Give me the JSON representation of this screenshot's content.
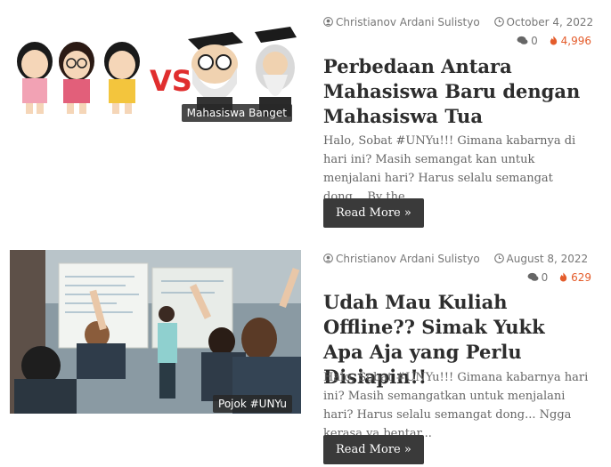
{
  "posts": [
    {
      "author": "Christianov Ardani Sulistyo",
      "date": "October 4, 2022",
      "comments": "0",
      "views": "4,996",
      "category": "Mahasiswa Banget",
      "title": "Perbedaan Antara Mahasiswa Baru dengan Mahasiswa Tua",
      "excerpt": "Halo, Sobat #UNYu!!! Gimana kabarnya di hari ini? Masih semangat kan untuk menjalani hari? Harus selalu semangat dong... By the...",
      "read_more": "Read More »",
      "image_text": "VS"
    },
    {
      "author": "Christianov Ardani Sulistyo",
      "date": "August 8, 2022",
      "comments": "0",
      "views": "629",
      "category": "Pojok #UNYu",
      "title": "Udah Mau Kuliah Offline?? Simak Yukk Apa Aja yang Perlu Disiapin!!",
      "excerpt": "Halo, Sobat #UNYu!!! Gimana kabarnya hari ini? Masih semangatkan untuk menjalani hari? Harus selalu semangat dong... Ngga kerasa ya bentar...",
      "read_more": "Read More »"
    }
  ],
  "colors": {
    "views": "#e45c2b",
    "button": "#3a3a3a",
    "title": "#2d2d2d"
  },
  "icons": [
    "user-icon",
    "clock-icon",
    "comment-icon",
    "fire-icon",
    "chevron-right-icon"
  ]
}
